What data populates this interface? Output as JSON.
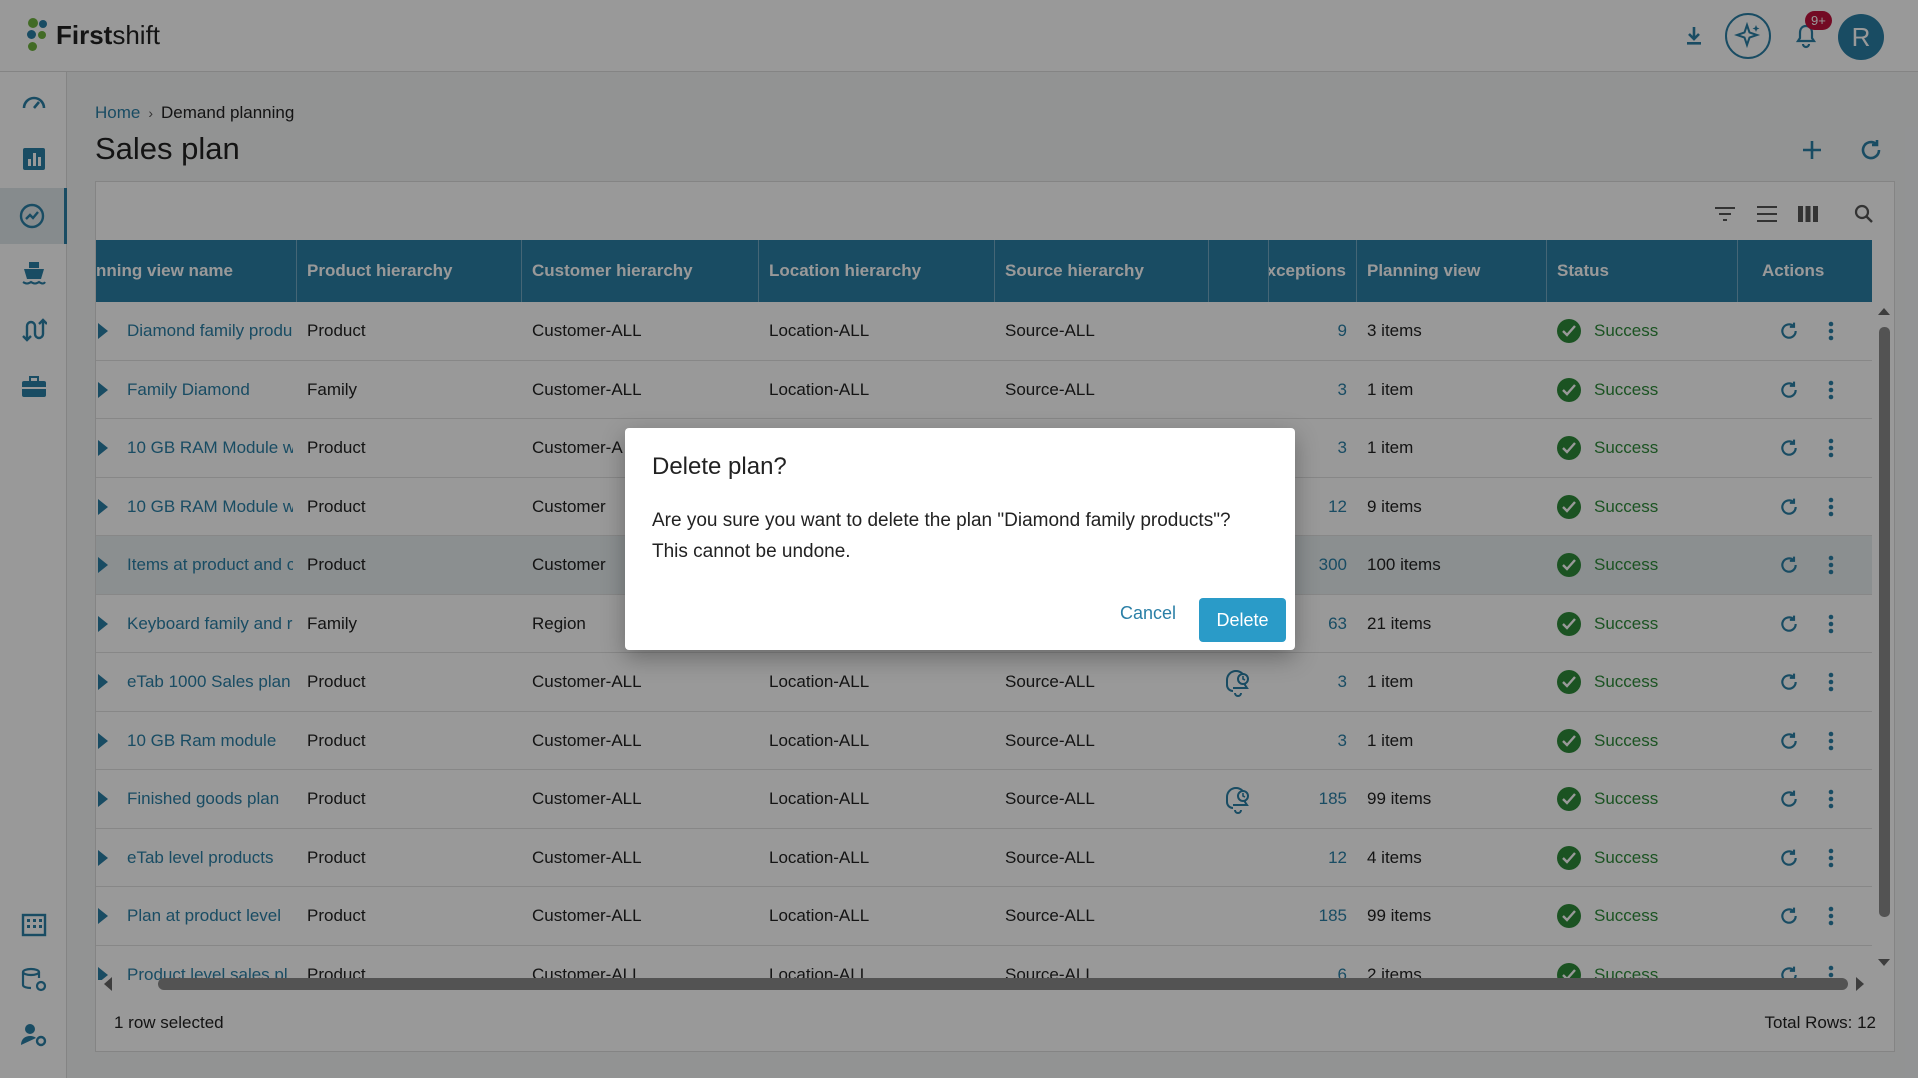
{
  "app": {
    "logo_bold": "First",
    "logo_light": "shift",
    "notif_count": "9+",
    "avatar_initial": "R"
  },
  "breadcrumb": {
    "home": "Home",
    "separator": "›",
    "current": "Demand planning"
  },
  "page": {
    "title": "Sales plan"
  },
  "columns": [
    {
      "label": "Planning view name",
      "shown": "nning view name"
    },
    {
      "label": "Product hierarchy"
    },
    {
      "label": "Customer hierarchy"
    },
    {
      "label": "Location hierarchy"
    },
    {
      "label": "Source hierarchy"
    },
    {
      "label": ""
    },
    {
      "label": "Exceptions"
    },
    {
      "label": "Planning view"
    },
    {
      "label": "Status"
    },
    {
      "label": "Actions"
    }
  ],
  "rows": [
    {
      "name": "Diamond family produ",
      "product": "Product",
      "customer": "Customer-ALL",
      "location": "Location-ALL",
      "source": "Source-ALL",
      "alert": false,
      "exceptions": "9",
      "view": "3 items",
      "status": "Success"
    },
    {
      "name": "Family Diamond",
      "product": "Family",
      "customer": "Customer-ALL",
      "location": "Location-ALL",
      "source": "Source-ALL",
      "alert": false,
      "exceptions": "3",
      "view": "1 item",
      "status": "Success"
    },
    {
      "name": "10 GB RAM Module w",
      "product": "Product",
      "customer": "Customer-A",
      "location": "",
      "source": "",
      "alert": false,
      "exceptions": "3",
      "view": "1 item",
      "status": "Success"
    },
    {
      "name": "10 GB RAM Module w",
      "product": "Product",
      "customer": "Customer",
      "location": "",
      "source": "",
      "alert": false,
      "exceptions": "12",
      "view": "9 items",
      "status": "Success"
    },
    {
      "name": "Items at product and c",
      "product": "Product",
      "customer": "Customer",
      "location": "",
      "source": "",
      "alert": false,
      "exceptions": "300",
      "view": "100 items",
      "status": "Success",
      "selected": true
    },
    {
      "name": "Keyboard family and r",
      "product": "Family",
      "customer": "Region",
      "location": "",
      "source": "",
      "alert": false,
      "exceptions": "63",
      "view": "21 items",
      "status": "Success"
    },
    {
      "name": "eTab 1000 Sales plan",
      "product": "Product",
      "customer": "Customer-ALL",
      "location": "Location-ALL",
      "source": "Source-ALL",
      "alert": true,
      "exceptions": "3",
      "view": "1 item",
      "status": "Success"
    },
    {
      "name": "10 GB Ram module",
      "product": "Product",
      "customer": "Customer-ALL",
      "location": "Location-ALL",
      "source": "Source-ALL",
      "alert": false,
      "exceptions": "3",
      "view": "1 item",
      "status": "Success"
    },
    {
      "name": "Finished goods plan",
      "product": "Product",
      "customer": "Customer-ALL",
      "location": "Location-ALL",
      "source": "Source-ALL",
      "alert": true,
      "exceptions": "185",
      "view": "99 items",
      "status": "Success"
    },
    {
      "name": "eTab level products",
      "product": "Product",
      "customer": "Customer-ALL",
      "location": "Location-ALL",
      "source": "Source-ALL",
      "alert": false,
      "exceptions": "12",
      "view": "4 items",
      "status": "Success"
    },
    {
      "name": "Plan at product level",
      "product": "Product",
      "customer": "Customer-ALL",
      "location": "Location-ALL",
      "source": "Source-ALL",
      "alert": false,
      "exceptions": "185",
      "view": "99 items",
      "status": "Success"
    },
    {
      "name": "Product level sales pl",
      "product": "Product",
      "customer": "Customer-ALL",
      "location": "Location-ALL",
      "source": "Source-ALL",
      "alert": false,
      "exceptions": "6",
      "view": "2 items",
      "status": "Success"
    }
  ],
  "footer": {
    "selected": "1 row selected",
    "total": "Total Rows: 12"
  },
  "dialog": {
    "title": "Delete plan?",
    "body_line1": "Are you sure you want to delete the plan \"Diamond family products\"?",
    "body_line2": "This cannot be undone.",
    "cancel": "Cancel",
    "confirm": "Delete"
  },
  "colors": {
    "accent": "#2a7fa6",
    "success": "#2e8b3a",
    "badge": "#c0123c",
    "primary_button": "#2a9bc8"
  }
}
